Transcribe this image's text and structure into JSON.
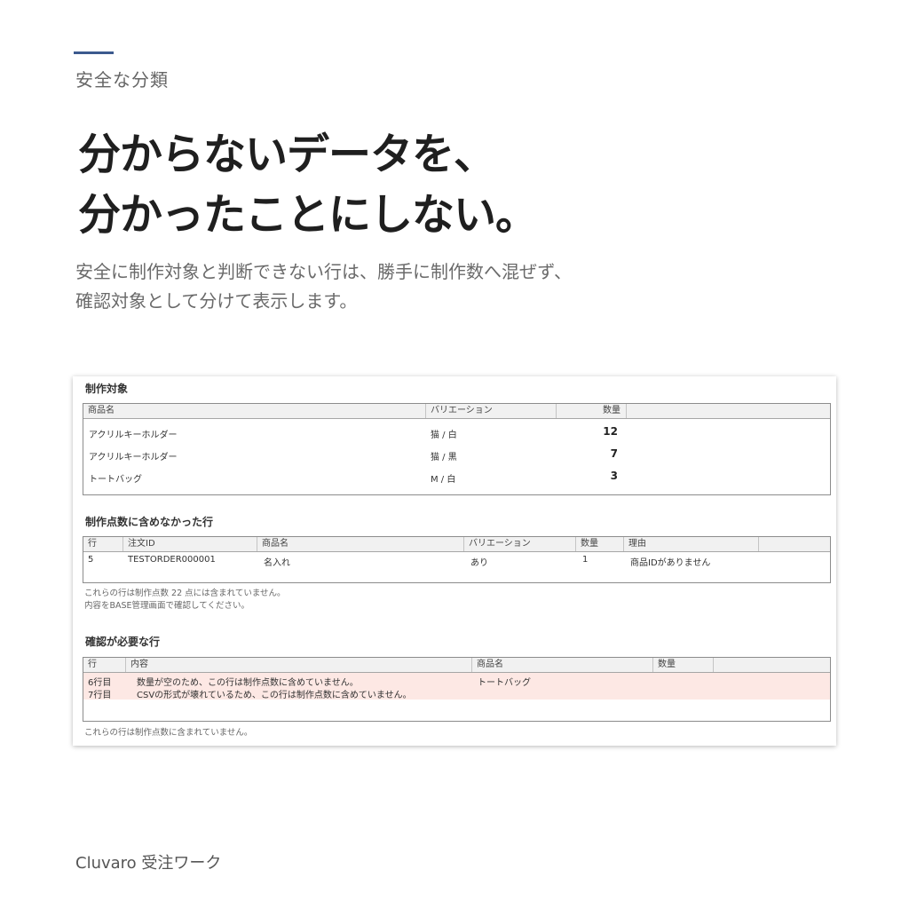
{
  "eyebrow": "安全な分類",
  "headline": {
    "line1": "分からないデータを、",
    "line2": "分かったことにしない。"
  },
  "subtitle": {
    "line1": "安全に制作対象と判断できない行は、勝手に制作数へ混ぜず、",
    "line2": "確認対象として分けて表示します。"
  },
  "footer": "Cluvaro 受注ワーク",
  "colors": {
    "accent": "#3c5a8e",
    "warning_row": "#fde8e4"
  },
  "panel": {
    "production": {
      "title": "制作対象",
      "columns": [
        "商品名",
        "バリエーション",
        "数量"
      ],
      "rows": [
        {
          "name": "アクリルキーホルダー",
          "variation": "猫 / 白",
          "qty": "12"
        },
        {
          "name": "アクリルキーホルダー",
          "variation": "猫 / 黒",
          "qty": "7"
        },
        {
          "name": "トートバッグ",
          "variation": "M / 白",
          "qty": "3"
        }
      ]
    },
    "excluded": {
      "title": "制作点数に含めなかった行",
      "columns": [
        "行",
        "注文ID",
        "商品名",
        "バリエーション",
        "数量",
        "理由"
      ],
      "rows": [
        {
          "row": "5",
          "order_id": "TESTORDER000001",
          "name": "名入れ",
          "variation": "あり",
          "qty": "1",
          "reason": "商品IDがありません"
        }
      ],
      "note_line1": "これらの行は制作点数 22 点には含まれていません。",
      "note_line2": "内容をBASE管理画面で確認してください。"
    },
    "review": {
      "title": "確認が必要な行",
      "columns": [
        "行",
        "内容",
        "商品名",
        "数量"
      ],
      "rows": [
        {
          "row": "6行目",
          "content": "数量が空のため、この行は制作点数に含めていません。",
          "name": "トートバッグ",
          "qty": ""
        },
        {
          "row": "7行目",
          "content": "CSVの形式が壊れているため、この行は制作点数に含めていません。",
          "name": "",
          "qty": ""
        }
      ],
      "note": "これらの行は制作点数に含まれていません。"
    }
  }
}
